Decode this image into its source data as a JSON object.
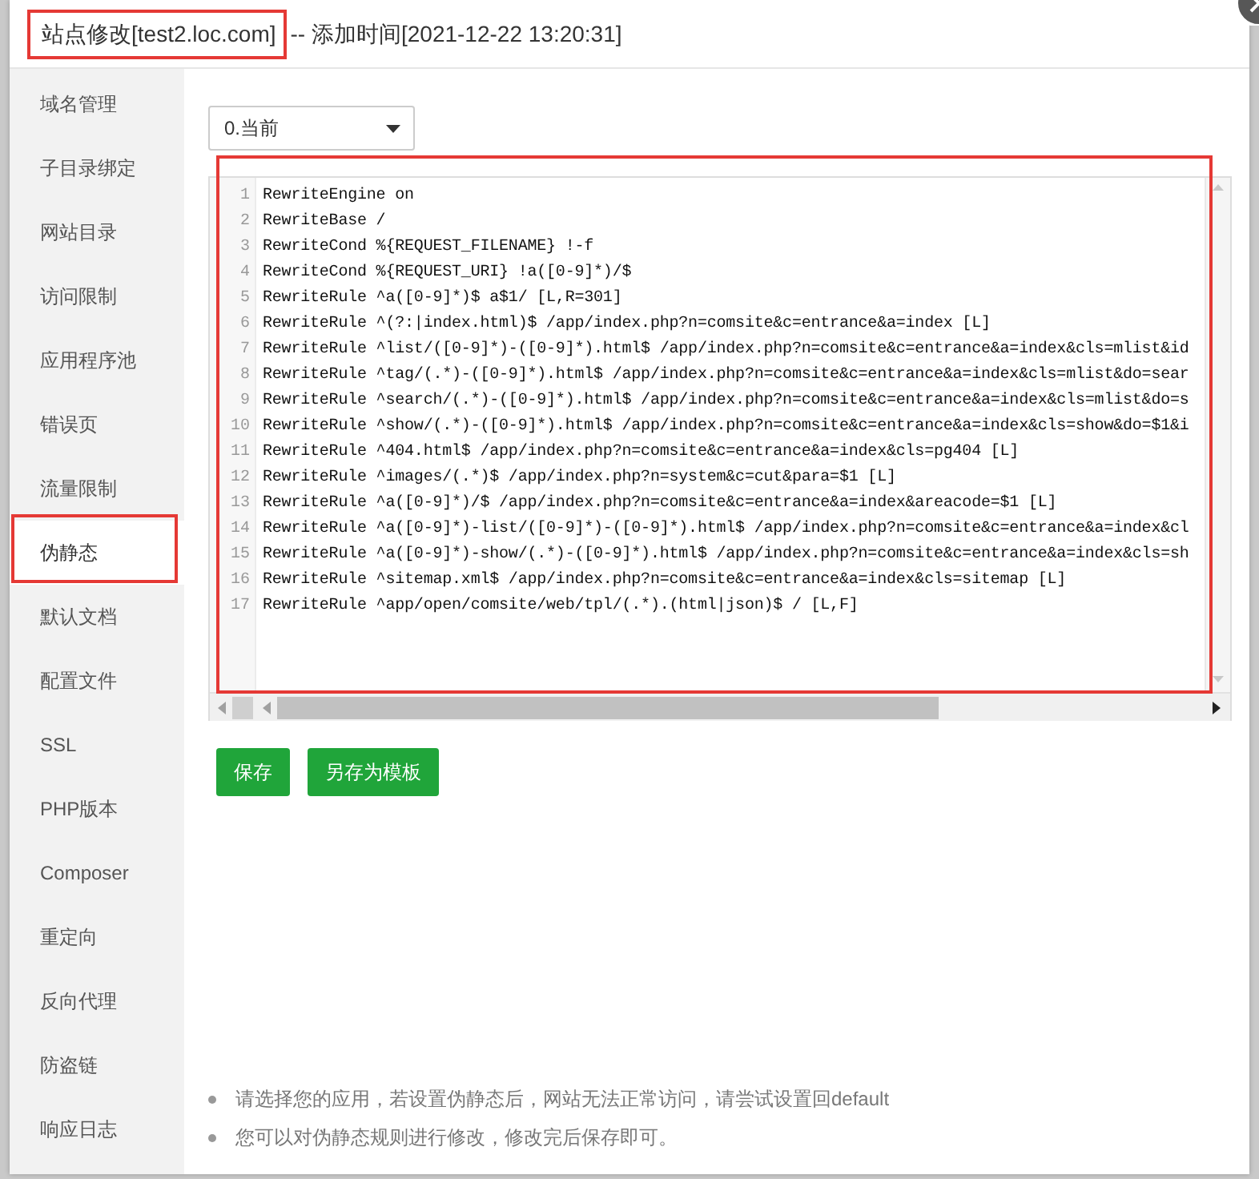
{
  "dialog": {
    "title": "站点修改[test2.loc.com]",
    "title_highlighted": true,
    "subtitle": "-- 添加时间[2021-12-22 13:20:31]"
  },
  "sidebar": {
    "items": [
      {
        "label": "域名管理",
        "selected": false,
        "highlighted": false
      },
      {
        "label": "子目录绑定",
        "selected": false,
        "highlighted": false
      },
      {
        "label": "网站目录",
        "selected": false,
        "highlighted": false
      },
      {
        "label": "访问限制",
        "selected": false,
        "highlighted": false
      },
      {
        "label": "应用程序池",
        "selected": false,
        "highlighted": false
      },
      {
        "label": "错误页",
        "selected": false,
        "highlighted": false
      },
      {
        "label": "流量限制",
        "selected": false,
        "highlighted": false
      },
      {
        "label": "伪静态",
        "selected": true,
        "highlighted": true
      },
      {
        "label": "默认文档",
        "selected": false,
        "highlighted": false
      },
      {
        "label": "配置文件",
        "selected": false,
        "highlighted": false
      },
      {
        "label": "SSL",
        "selected": false,
        "highlighted": false
      },
      {
        "label": "PHP版本",
        "selected": false,
        "highlighted": false
      },
      {
        "label": "Composer",
        "selected": false,
        "highlighted": false
      },
      {
        "label": "重定向",
        "selected": false,
        "highlighted": false
      },
      {
        "label": "反向代理",
        "selected": false,
        "highlighted": false
      },
      {
        "label": "防盗链",
        "selected": false,
        "highlighted": false
      },
      {
        "label": "响应日志",
        "selected": false,
        "highlighted": false
      }
    ]
  },
  "rewrite": {
    "template": "0.当前",
    "editor": {
      "highlighted": true,
      "lines": [
        {
          "number": "1",
          "code": "RewriteEngine on"
        },
        {
          "number": "2",
          "code": "RewriteBase /"
        },
        {
          "number": "3",
          "code": "RewriteCond %{REQUEST_FILENAME} !-f"
        },
        {
          "number": "4",
          "code": "RewriteCond %{REQUEST_URI} !a([0-9]*)/$"
        },
        {
          "number": "5",
          "code": "RewriteRule ^a([0-9]*)$ a$1/ [L,R=301]"
        },
        {
          "number": "6",
          "code": "RewriteRule ^(?:|index.html)$ /app/index.php?n=comsite&c=entrance&a=index [L]"
        },
        {
          "number": "7",
          "code": "RewriteRule ^list/([0-9]*)-([0-9]*).html$ /app/index.php?n=comsite&c=entrance&a=index&cls=mlist&id"
        },
        {
          "number": "8",
          "code": "RewriteRule ^tag/(.*)-([0-9]*).html$ /app/index.php?n=comsite&c=entrance&a=index&cls=mlist&do=sear"
        },
        {
          "number": "9",
          "code": "RewriteRule ^search/(.*)-([0-9]*).html$ /app/index.php?n=comsite&c=entrance&a=index&cls=mlist&do=s"
        },
        {
          "number": "10",
          "code": "RewriteRule ^show/(.*)-([0-9]*).html$ /app/index.php?n=comsite&c=entrance&a=index&cls=show&do=$1&i"
        },
        {
          "number": "11",
          "code": "RewriteRule ^404.html$ /app/index.php?n=comsite&c=entrance&a=index&cls=pg404 [L]"
        },
        {
          "number": "12",
          "code": "RewriteRule ^images/(.*)$ /app/index.php?n=system&c=cut&para=$1 [L]"
        },
        {
          "number": "13",
          "code": "RewriteRule ^a([0-9]*)/$ /app/index.php?n=comsite&c=entrance&a=index&areacode=$1 [L]"
        },
        {
          "number": "14",
          "code": "RewriteRule ^a([0-9]*)-list/([0-9]*)-([0-9]*).html$ /app/index.php?n=comsite&c=entrance&a=index&cl"
        },
        {
          "number": "15",
          "code": "RewriteRule ^a([0-9]*)-show/(.*)-([0-9]*).html$ /app/index.php?n=comsite&c=entrance&a=index&cls=sh"
        },
        {
          "number": "16",
          "code": "RewriteRule ^sitemap.xml$ /app/index.php?n=comsite&c=entrance&a=index&cls=sitemap [L]"
        },
        {
          "number": "17",
          "code": "RewriteRule ^app/open/comsite/web/tpl/(.*).(html|json)$ / [L,F]"
        }
      ]
    },
    "buttons": [
      "保存",
      "另存为模板"
    ],
    "notes": [
      "请选择您的应用，若设置伪静态后，网站无法正常访问，请尝试设置回default",
      "您可以对伪静态规则进行修改，修改完后保存即可。"
    ]
  }
}
